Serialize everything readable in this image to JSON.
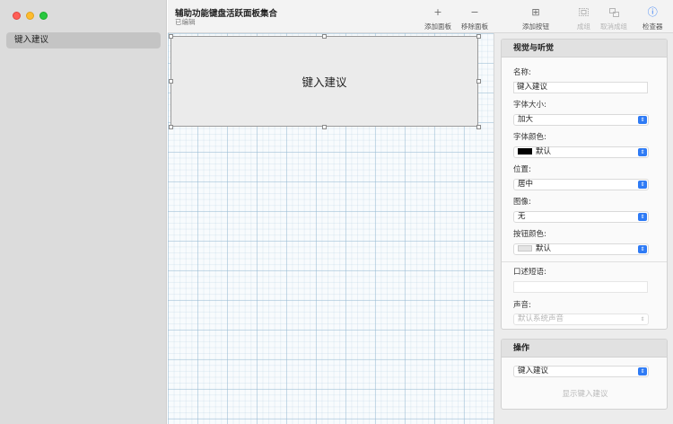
{
  "window": {
    "title": "辅助功能键盘活跃面板集合",
    "subtitle": "已编辑"
  },
  "sidebar": {
    "items": [
      {
        "label": "键入建议",
        "selected": true
      }
    ]
  },
  "toolbar": {
    "add_panel": "添加面板",
    "remove_panel": "移除面板",
    "add_button": "添加按钮",
    "group": "成组",
    "ungroup": "取消成组",
    "inspector": "检查器",
    "add_panel_icon": "+",
    "remove_panel_icon": "−",
    "add_button_icon": "⊞",
    "inspector_icon": "ⓘ"
  },
  "canvas": {
    "button_label": "键入建议"
  },
  "inspector": {
    "visual": {
      "header": "视觉与听觉",
      "name_label": "名称:",
      "name_value": "键入建议",
      "font_size_label": "字体大小:",
      "font_size_value": "加大",
      "font_color_label": "字体颜色:",
      "font_color_value": "默认",
      "font_color_swatch": "#000000",
      "position_label": "位置:",
      "position_value": "居中",
      "image_label": "图像:",
      "image_value": "无",
      "button_color_label": "按钮颜色:",
      "button_color_value": "默认",
      "button_color_swatch": "#e4e4e4",
      "spoken_label": "口述短语:",
      "spoken_value": "",
      "sound_label": "声音:",
      "sound_value": "默认系统声音"
    },
    "action": {
      "header": "操作",
      "action_value": "键入建议",
      "show_label": "显示键入建议"
    }
  },
  "colors": {
    "accent": "#2f7bf5",
    "close": "#ff5f57",
    "minimize": "#febc2e",
    "maximize": "#28c840"
  }
}
